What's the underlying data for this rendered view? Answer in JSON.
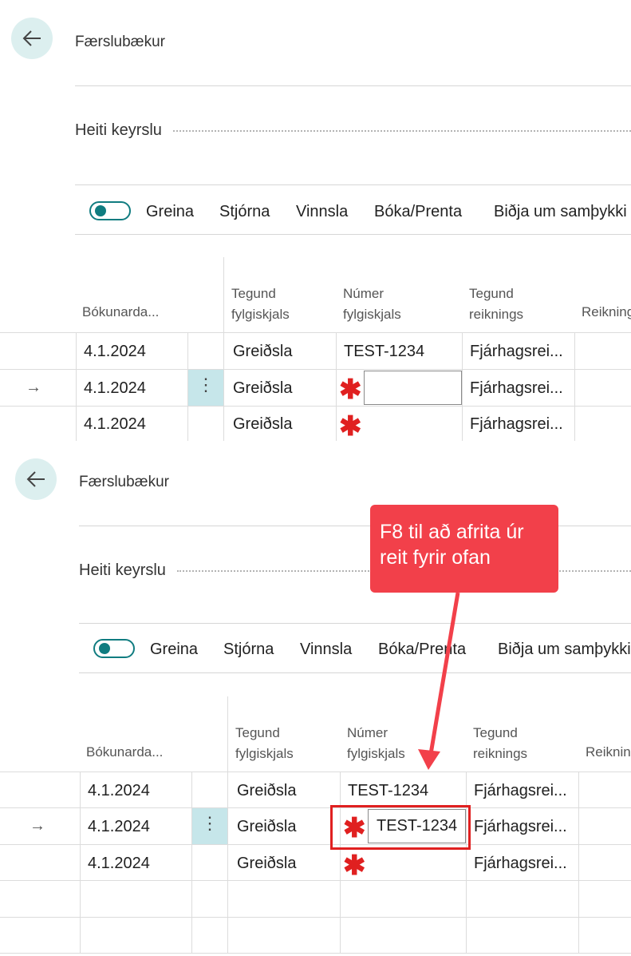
{
  "panels": [
    {
      "back_icon": "arrow-left-icon",
      "title": "Færslubækur",
      "batch_label": "Heiti keyrslu",
      "actions": [
        "Greina",
        "Stjórna",
        "Vinnsla",
        "Bóka/Prenta",
        "Biðja um samþykki"
      ],
      "columns": {
        "posting_date": "Bókunarda...",
        "doc_type_1": "Tegund",
        "doc_type_2": "fylgiskjals",
        "doc_no_1": "Númer",
        "doc_no_2": "fylgiskjals",
        "acc_type_1": "Tegund",
        "acc_type_2": "reiknings",
        "account": "Reikning"
      },
      "rows": [
        {
          "date": "4.1.2024",
          "doc_type": "Greiðsla",
          "doc_no": "TEST-1234",
          "acc_type": "Fjárhagsrei..."
        },
        {
          "date": "4.1.2024",
          "doc_type": "Greiðsla",
          "doc_no": "",
          "acc_type": "Fjárhagsrei..."
        },
        {
          "date": "4.1.2024",
          "doc_type": "Greiðsla",
          "doc_no": "",
          "acc_type": "Fjárhagsrei..."
        }
      ]
    },
    {
      "back_icon": "arrow-left-icon",
      "title": "Færslubækur",
      "batch_label": "Heiti keyrslu",
      "actions": [
        "Greina",
        "Stjórna",
        "Vinnsla",
        "Bóka/Prenta",
        "Biðja um samþykki"
      ],
      "columns": {
        "posting_date": "Bókunarda...",
        "doc_type_1": "Tegund",
        "doc_type_2": "fylgiskjals",
        "doc_no_1": "Númer",
        "doc_no_2": "fylgiskjals",
        "acc_type_1": "Tegund",
        "acc_type_2": "reiknings",
        "account": "Reiknin"
      },
      "rows": [
        {
          "date": "4.1.2024",
          "doc_type": "Greiðsla",
          "doc_no": "TEST-1234",
          "acc_type": "Fjárhagsrei..."
        },
        {
          "date": "4.1.2024",
          "doc_type": "Greiðsla",
          "doc_no": "TEST-1234",
          "acc_type": "Fjárhagsrei..."
        },
        {
          "date": "4.1.2024",
          "doc_type": "Greiðsla",
          "doc_no": "",
          "acc_type": "Fjárhagsrei..."
        }
      ]
    }
  ],
  "row_marker": "→",
  "menu_glyph": "⋮",
  "required_glyph": "✱",
  "callout": {
    "line1": "F8 til að afrita úr",
    "line2": "reit fyrir ofan",
    "color": "#f2404a"
  },
  "colors": {
    "accent": "#107c80",
    "required": "#e02020",
    "selected_cell": "#c6e6ea"
  }
}
